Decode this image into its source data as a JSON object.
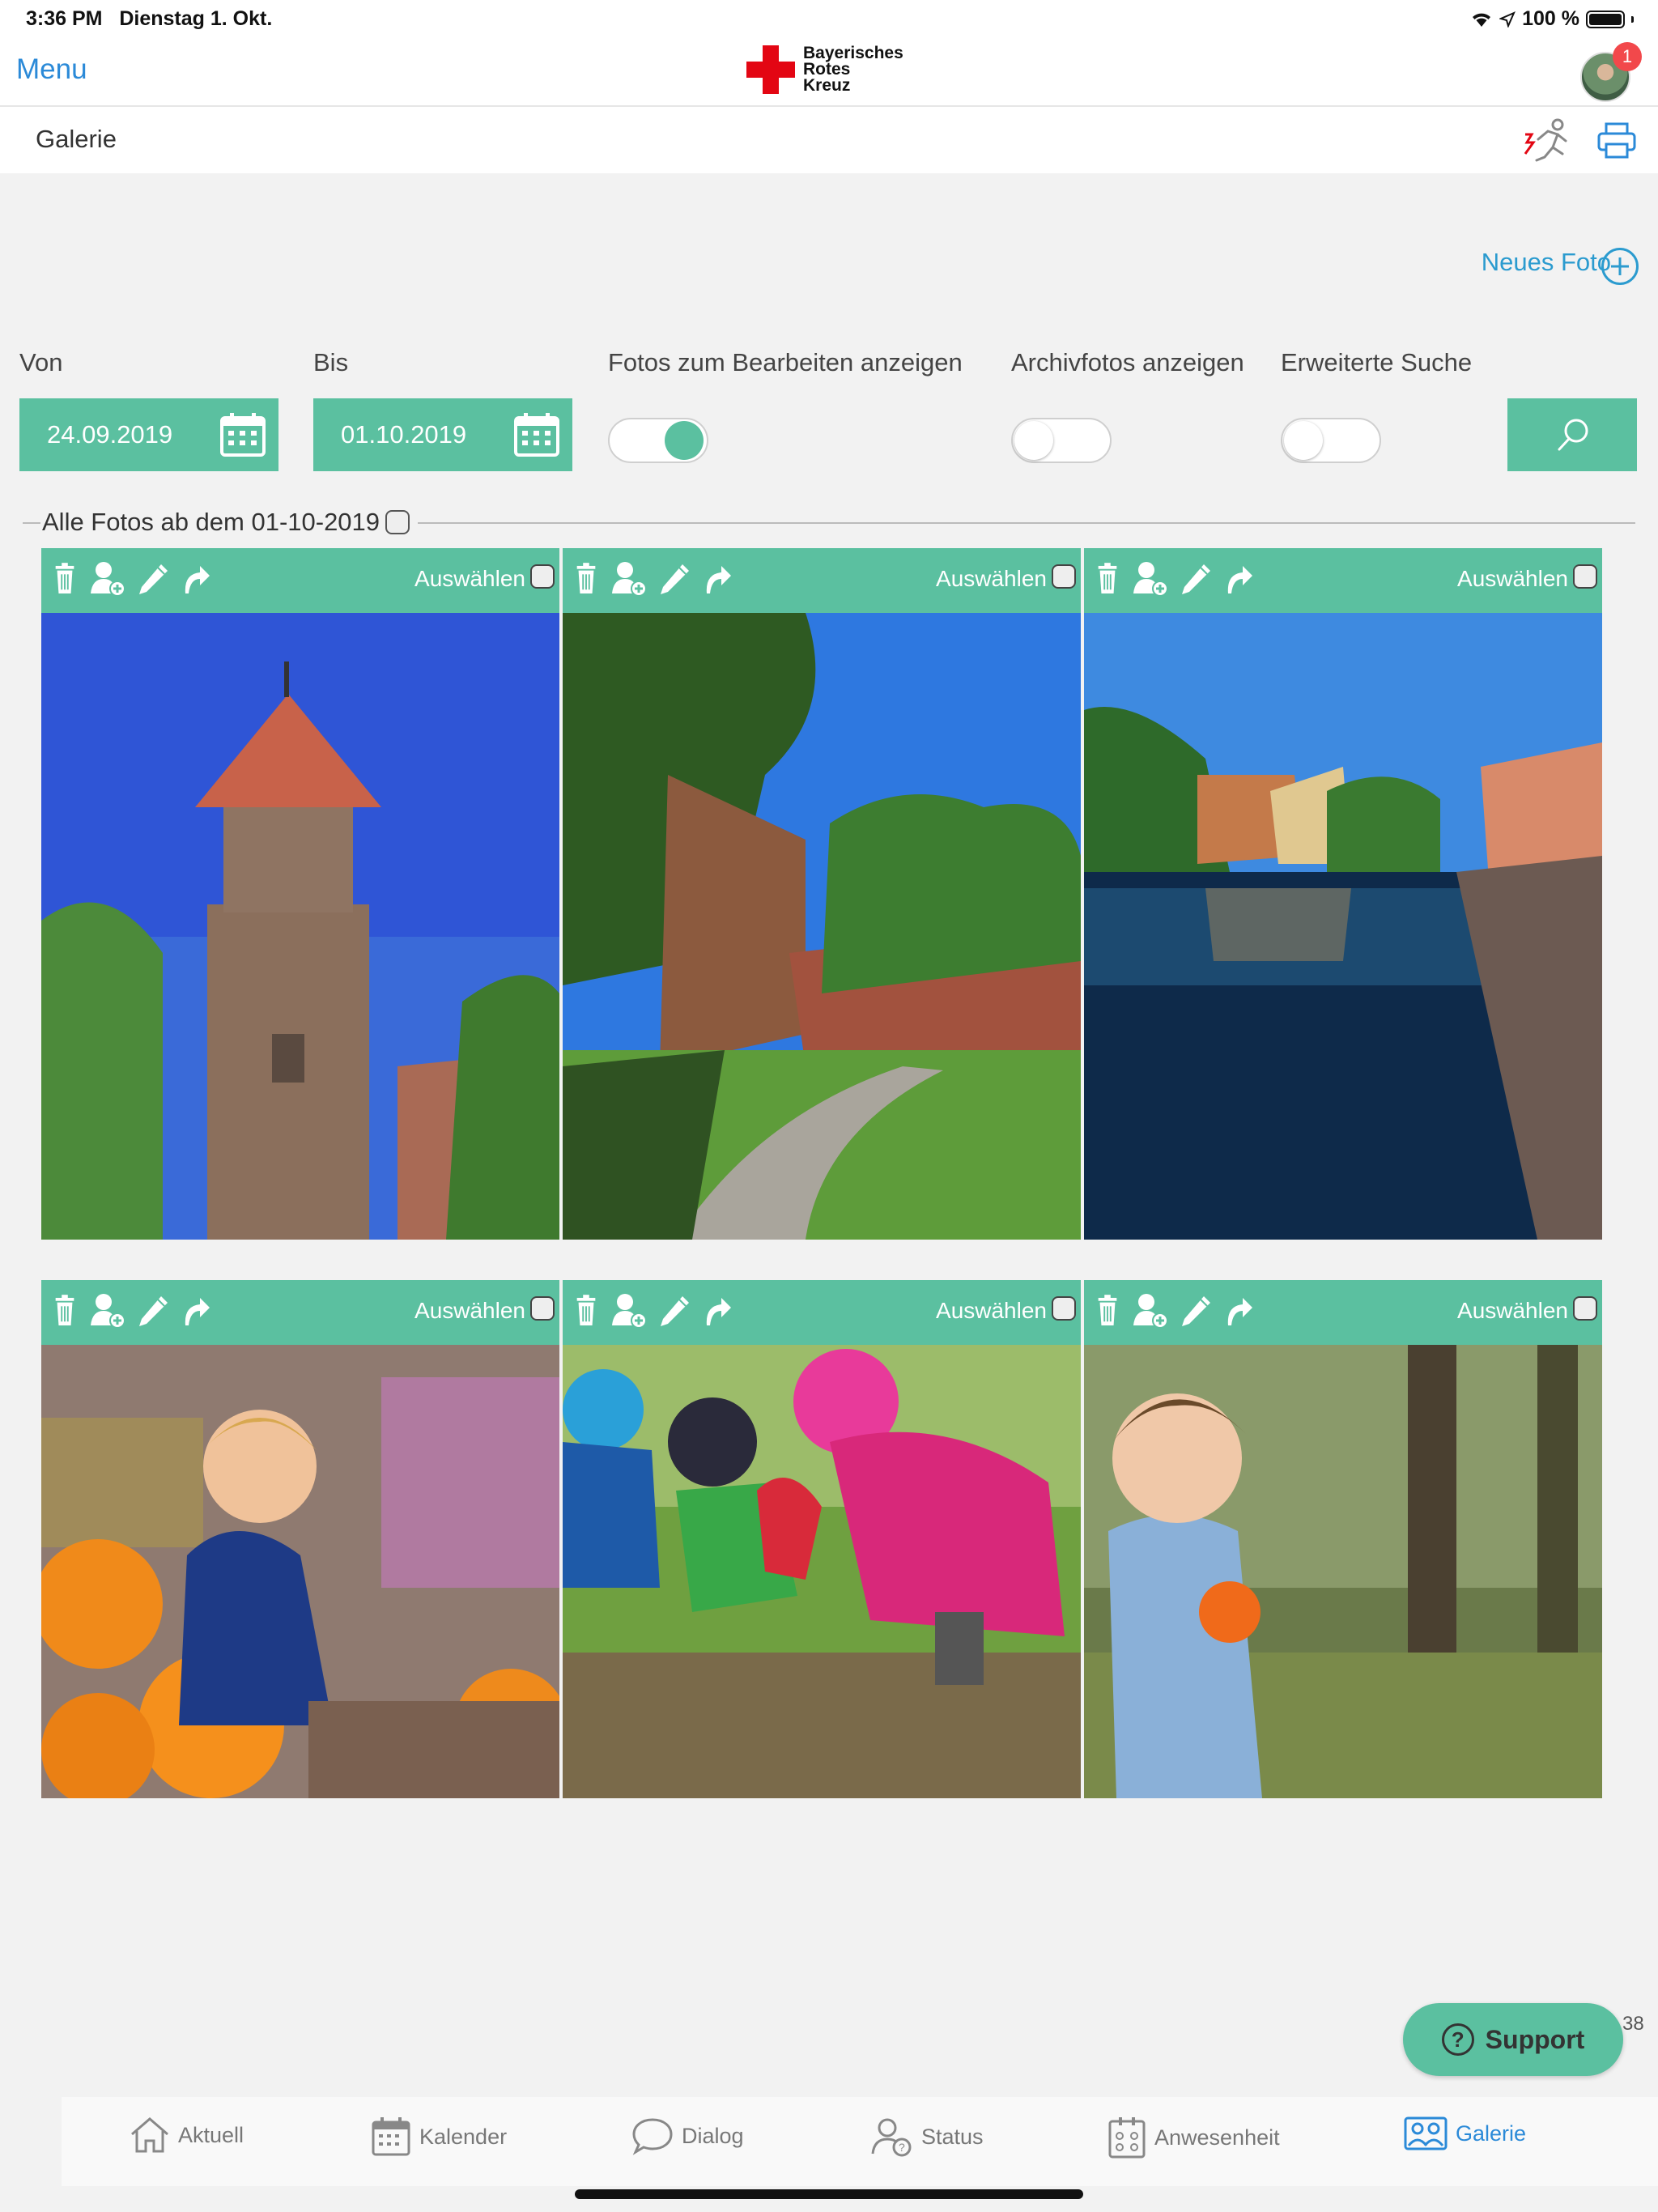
{
  "status_bar": {
    "time": "3:36 PM",
    "date": "Dienstag 1. Okt.",
    "battery": "100 %"
  },
  "nav": {
    "menu_label": "Menu",
    "logo_lines": [
      "Bayerisches",
      "Rotes",
      "Kreuz"
    ],
    "notification_count": "1"
  },
  "page": {
    "title": "Galerie"
  },
  "actions": {
    "new_photo_label": "Neues Foto"
  },
  "filters": {
    "from_label": "Von",
    "from_value": "24.09.2019",
    "to_label": "Bis",
    "to_value": "01.10.2019",
    "edit_toggle_label": "Fotos zum Bearbeiten anzeigen",
    "edit_toggle_on": true,
    "archive_toggle_label": "Archivfotos anzeigen",
    "archive_toggle_on": false,
    "advanced_label": "Erweiterte Suche",
    "advanced_on": false
  },
  "section": {
    "label": "Alle Fotos ab dem 01-10-2019"
  },
  "photos": [
    {
      "select_label": "Auswählen",
      "subject": "tower"
    },
    {
      "select_label": "Auswählen",
      "subject": "park-path"
    },
    {
      "select_label": "Auswählen",
      "subject": "river"
    },
    {
      "select_label": "Auswählen",
      "subject": "boy-pumpkins"
    },
    {
      "select_label": "Auswählen",
      "subject": "kids-playing"
    },
    {
      "select_label": "Auswählen",
      "subject": "toddler"
    }
  ],
  "support": {
    "label": "Support",
    "side_number": "38"
  },
  "tabs": [
    {
      "label": "Aktuell",
      "icon": "home-icon"
    },
    {
      "label": "Kalender",
      "icon": "calendar-icon"
    },
    {
      "label": "Dialog",
      "icon": "speech-bubble-icon"
    },
    {
      "label": "Status",
      "icon": "user-status-icon"
    },
    {
      "label": "Anwesenheit",
      "icon": "attendance-icon"
    },
    {
      "label": "Galerie",
      "icon": "gallery-icon",
      "active": true
    }
  ],
  "colors": {
    "accent": "#5bc0a0",
    "link": "#2b8ad8",
    "brand_red": "#e30613"
  }
}
